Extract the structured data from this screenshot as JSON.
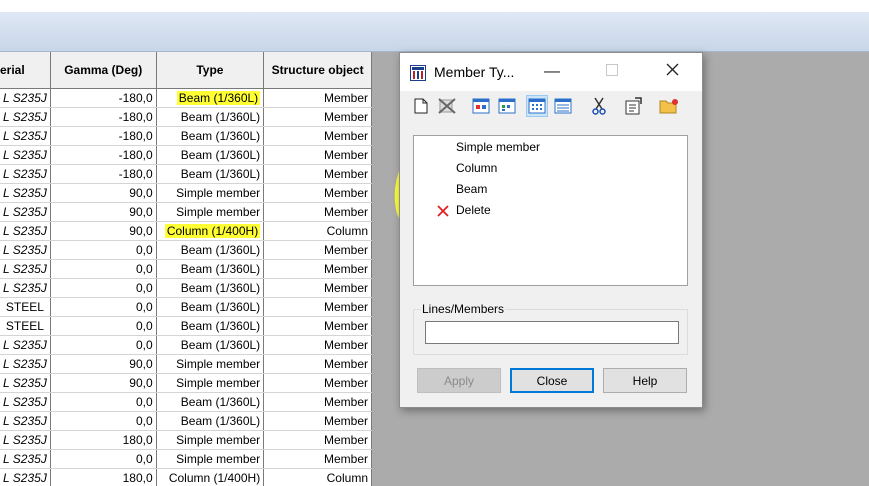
{
  "grid": {
    "headers": [
      "erial",
      "Gamma (Deg)",
      "Type",
      "Structure object"
    ],
    "rows": [
      [
        "L S235J",
        "-180,0",
        "Beam (1/360L)",
        "Member",
        true
      ],
      [
        "L S235J",
        "-180,0",
        "Beam (1/360L)",
        "Member",
        false
      ],
      [
        "L S235J",
        "-180,0",
        "Beam (1/360L)",
        "Member",
        false
      ],
      [
        "L S235J",
        "-180,0",
        "Beam (1/360L)",
        "Member",
        false
      ],
      [
        "L S235J",
        "-180,0",
        "Beam (1/360L)",
        "Member",
        false
      ],
      [
        "L S235J",
        "90,0",
        "Simple member",
        "Member",
        false
      ],
      [
        "L S235J",
        "90,0",
        "Simple member",
        "Member",
        false
      ],
      [
        "L S235J",
        "90,0",
        "Column (1/400H)",
        "Column",
        true
      ],
      [
        "L S235J",
        "0,0",
        "Beam (1/360L)",
        "Member",
        false
      ],
      [
        "L S235J",
        "0,0",
        "Beam (1/360L)",
        "Member",
        false
      ],
      [
        "L S235J",
        "0,0",
        "Beam (1/360L)",
        "Member",
        false
      ],
      [
        "STEEL",
        "0,0",
        "Beam (1/360L)",
        "Member",
        false
      ],
      [
        "STEEL",
        "0,0",
        "Beam (1/360L)",
        "Member",
        false
      ],
      [
        "L S235J",
        "0,0",
        "Beam (1/360L)",
        "Member",
        false
      ],
      [
        "L S235J",
        "90,0",
        "Simple member",
        "Member",
        false
      ],
      [
        "L S235J",
        "90,0",
        "Simple member",
        "Member",
        false
      ],
      [
        "L S235J",
        "0,0",
        "Beam (1/360L)",
        "Member",
        false
      ],
      [
        "L S235J",
        "0,0",
        "Beam (1/360L)",
        "Member",
        false
      ],
      [
        "L S235J",
        "180,0",
        "Simple member",
        "Member",
        false
      ],
      [
        "L S235J",
        "0,0",
        "Simple member",
        "Member",
        false
      ],
      [
        "L S235J",
        "180,0",
        "Column (1/400H)",
        "Column",
        false
      ]
    ]
  },
  "dialog": {
    "title": "Member Ty...",
    "minimize_icon": "minimize-icon",
    "maximize_icon": "maximize-icon",
    "close_icon": "close-icon",
    "toolbar_icons": [
      "new-document-icon",
      "delete-x-icon",
      "view-large-icon",
      "view-small-icon",
      "view-list-icon",
      "view-details-icon",
      "scissors-icon",
      "properties-icon",
      "open-folder-icon"
    ],
    "list_items": [
      "Simple member",
      "Column",
      "Beam",
      "Delete"
    ],
    "lines_members_label": "Lines/Members",
    "lines_members_value": "",
    "apply_label": "Apply",
    "close_label": "Close",
    "help_label": "Help"
  },
  "colors": {
    "highlight": "#ffff33",
    "focus": "#0078d7",
    "delete_red": "#e02020"
  }
}
